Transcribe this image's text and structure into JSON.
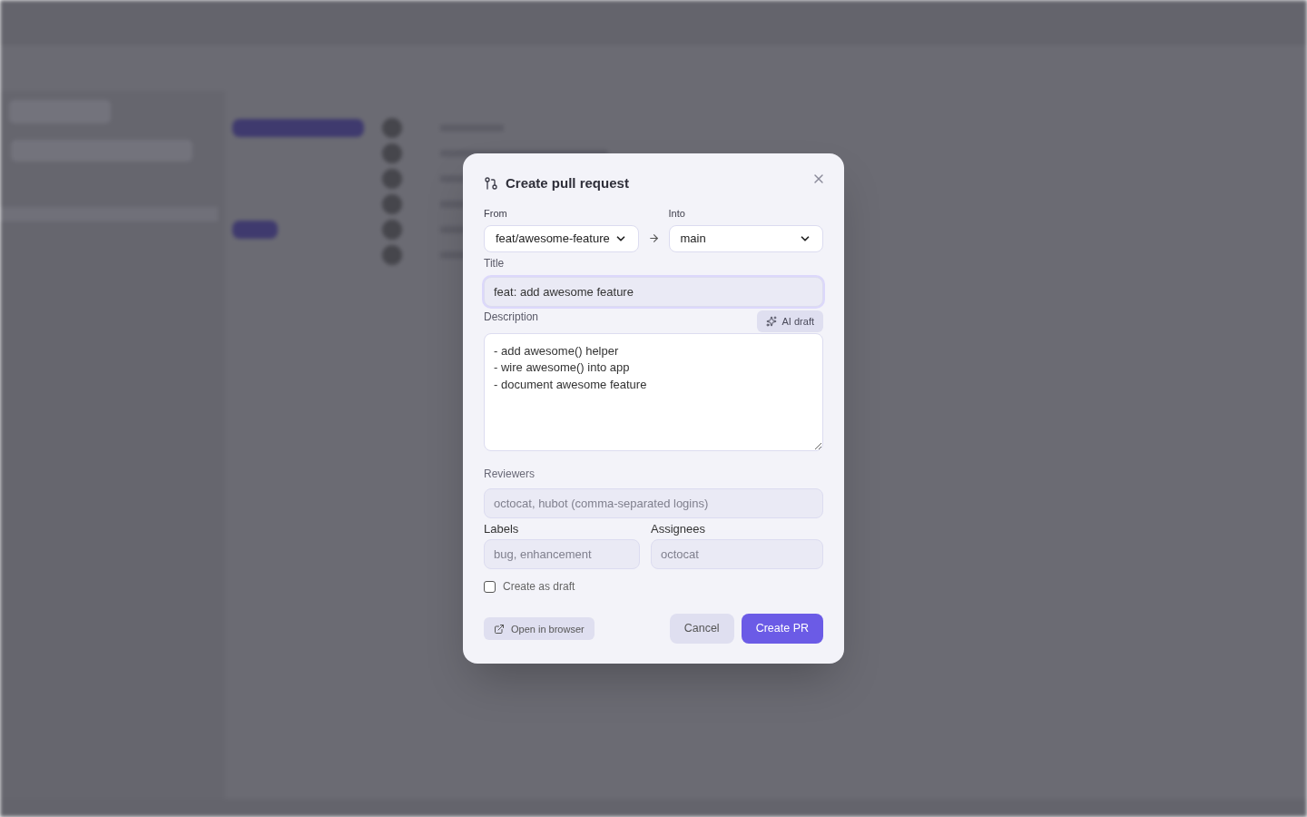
{
  "dialog": {
    "title": "Create pull request",
    "from": {
      "label": "From",
      "value": "feat/awesome-feature"
    },
    "into": {
      "label": "Into",
      "value": "main"
    },
    "title_field": {
      "label": "Title",
      "value": "feat: add awesome feature",
      "focused": true
    },
    "description": {
      "label": "Description",
      "ai_button": "AI draft",
      "value": "- add awesome() helper\n- wire awesome() into app\n- document awesome feature"
    },
    "reviewers": {
      "label": "Reviewers",
      "placeholder": "octocat, hubot (comma-separated logins)"
    },
    "labels": {
      "label": "Labels",
      "placeholder": "bug, enhancement"
    },
    "assignees": {
      "label": "Assignees",
      "placeholder": "octocat"
    },
    "draft": {
      "label": "Create as draft",
      "checked": false
    },
    "open_browser": "Open in browser",
    "cancel": "Cancel",
    "submit": "Create PR"
  }
}
